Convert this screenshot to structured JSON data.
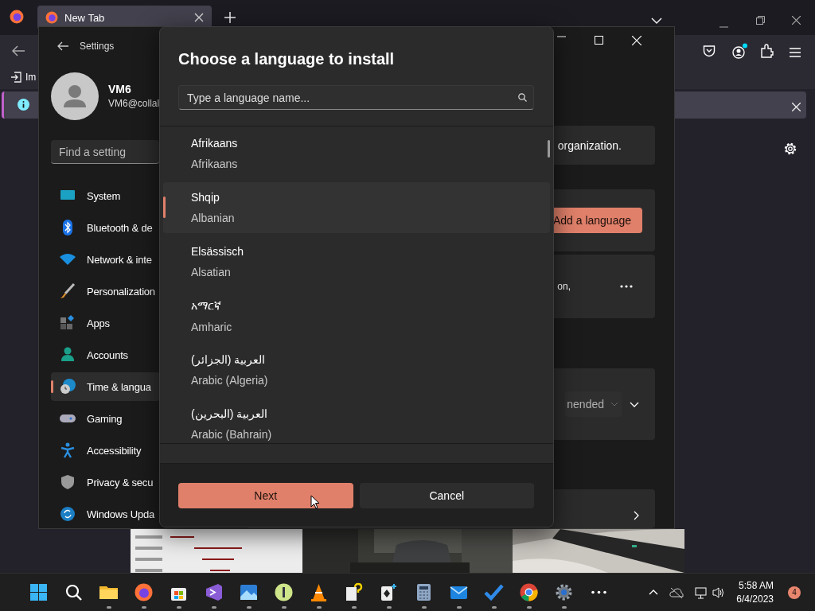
{
  "browser": {
    "tabs": [
      {
        "label": "New Tab",
        "selected": true
      }
    ],
    "bookmark": "Im"
  },
  "settings": {
    "title": "Settings",
    "user": {
      "name": "VM6",
      "email": "VM6@collal"
    },
    "search": {
      "placeholder": "Find a setting"
    },
    "nav": [
      {
        "label": "System",
        "kind": "system",
        "selected": false
      },
      {
        "label": "Bluetooth & de",
        "kind": "bluetooth",
        "selected": false
      },
      {
        "label": "Network & inte",
        "kind": "network",
        "selected": false
      },
      {
        "label": "Personalization",
        "kind": "brush",
        "selected": false
      },
      {
        "label": "Apps",
        "kind": "apps",
        "selected": false
      },
      {
        "label": "Accounts",
        "kind": "person",
        "selected": false
      },
      {
        "label": "Time & langua",
        "kind": "time",
        "selected": true
      },
      {
        "label": "Gaming",
        "kind": "gamepad",
        "selected": false
      },
      {
        "label": "Accessibility",
        "kind": "accessibility",
        "selected": false
      },
      {
        "label": "Privacy & secu",
        "kind": "shield",
        "selected": false
      },
      {
        "label": "Windows Upda",
        "kind": "update",
        "selected": false
      }
    ],
    "content": {
      "card_1": "organization.",
      "add_button": "Add a language",
      "card_3": "on,",
      "dropdown": "nended"
    }
  },
  "dialog": {
    "title": "Choose a language to install",
    "search": {
      "placeholder": "Type a language name..."
    },
    "languages": [
      {
        "name": "Afrikaans",
        "english": "Afrikaans",
        "selected": false
      },
      {
        "name": "Shqip",
        "english": "Albanian",
        "selected": true
      },
      {
        "name": "Elsässisch",
        "english": "Alsatian",
        "selected": false
      },
      {
        "name": "አማርኛ",
        "english": "Amharic",
        "selected": false
      },
      {
        "name": "العربية (الجزائر)",
        "english": "Arabic (Algeria)",
        "selected": false
      },
      {
        "name": "العربية (البحرين)",
        "english": "Arabic (Bahrain)",
        "selected": false
      }
    ],
    "buttons": [
      {
        "label": "Next",
        "kind": "primary"
      },
      {
        "label": "Cancel",
        "kind": "secondary"
      }
    ]
  },
  "taskbar": {
    "time": "5:58 AM",
    "date": "6/4/2023",
    "badge": "4"
  }
}
